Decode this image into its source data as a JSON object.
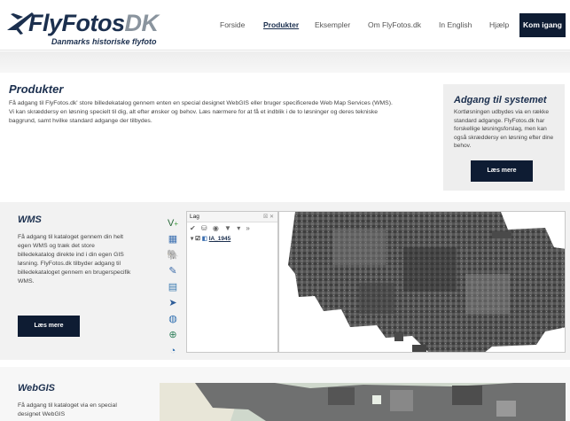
{
  "header": {
    "logo_main": "FlyFotos",
    "logo_suffix": "DK",
    "logo_tagline": "Danmarks historiske flyfoto",
    "nav": [
      {
        "label": "Forside",
        "active": false
      },
      {
        "label": "Produkter",
        "active": true
      },
      {
        "label": "Eksempler",
        "active": false
      },
      {
        "label": "Om FlyFotos.dk",
        "active": false
      },
      {
        "label": "In English",
        "active": false
      },
      {
        "label": "Hjælp",
        "active": false
      }
    ],
    "cta": "Kom igang"
  },
  "produkter": {
    "title": "Produkter",
    "text": "Få adgang til FlyFotos.dk' store billedekatalog gennem enten en special designet WebGIS eller bruger specificerede Web Map Services (WMS). Vi kan skræddersy en løsning specielt til dig, alt efter ønsker og behov. Læs nærmere for at få et indblik i de to løsninger og deres tekniske baggrund, samt hvilke standard adgange der tilbydes."
  },
  "aside": {
    "title": "Adgang til systemet",
    "text": "Kortløsningen udbydes via en række standard adgange. FlyFotos.dk har forskellige løsningsforslag, men kan også skræddersy en løsning efter dine behov.",
    "button": "Læs mere"
  },
  "wms": {
    "title": "WMS",
    "text": "Få adgang til kataloget gennem din helt egen WMS og træk det store billedekatalog direkte ind i din egen GIS løsning. FlyFotos.dk tilbyder adgang til billedekataloget gennem en brugerspecifik WMS.",
    "button": "Læs mere",
    "layers_panel": {
      "title": "Lag",
      "close": "☒ ✕",
      "tools": "✔ ⛁ ◉ ▼ ▾ »",
      "layer_name": "IA_1945"
    }
  },
  "webgis": {
    "title": "WebGIS",
    "text": "Få adgang til kataloget via en special designet WebGIS"
  },
  "colors": {
    "navy": "#0e1c33",
    "brand": "#1b2f4e"
  }
}
